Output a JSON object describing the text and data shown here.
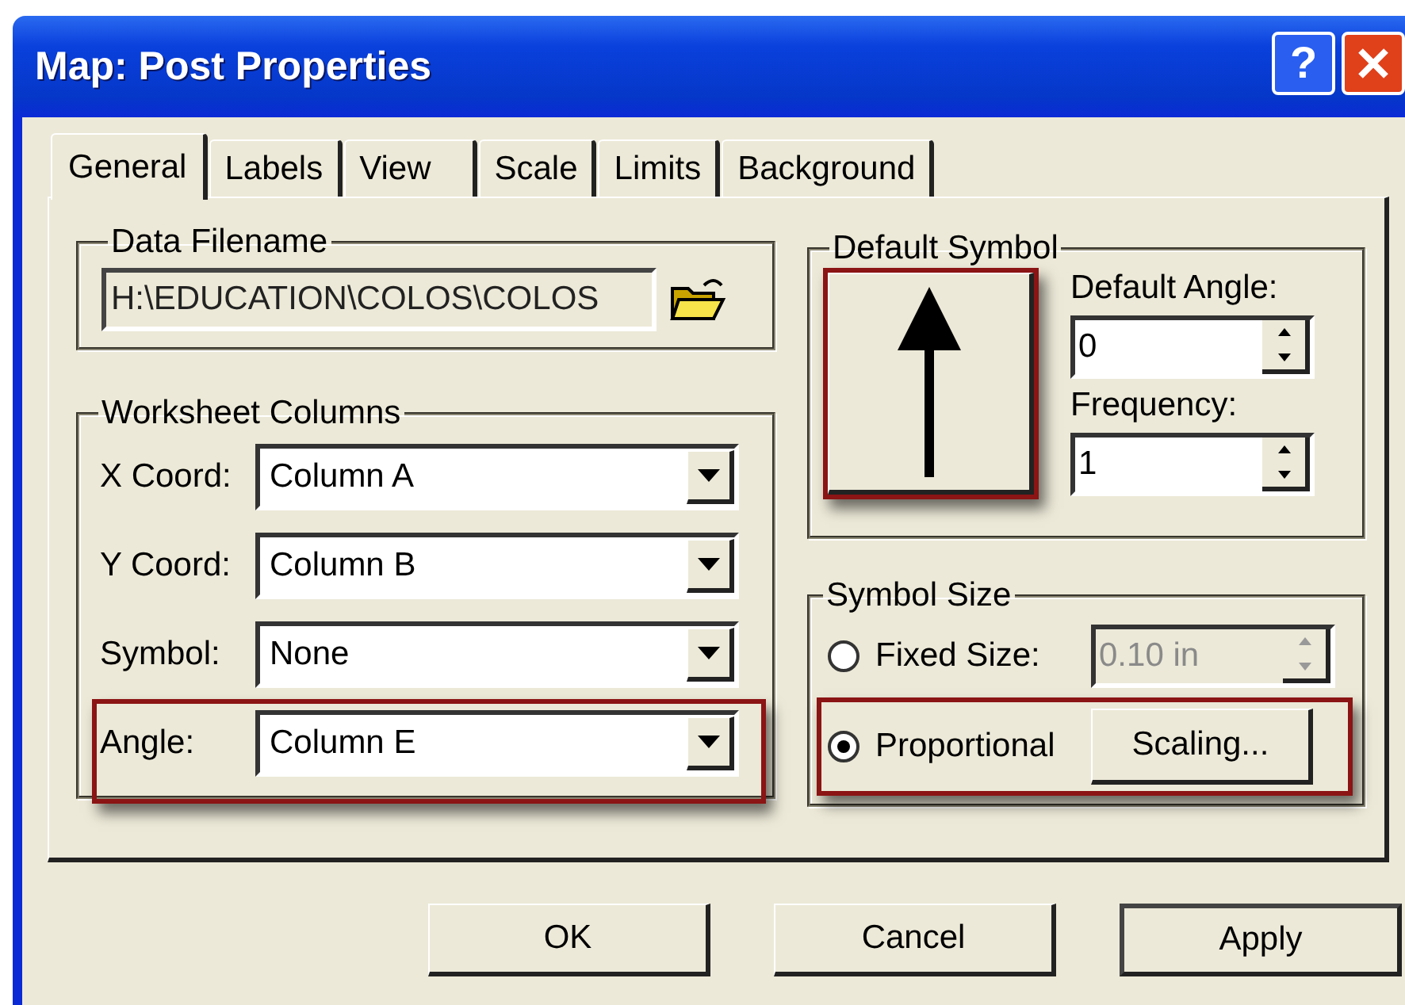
{
  "window": {
    "title": "Map: Post Properties",
    "help_label": "?"
  },
  "tabs": [
    {
      "label": "General",
      "selected": true
    },
    {
      "label": "Labels",
      "selected": false
    },
    {
      "label": "View",
      "selected": false
    },
    {
      "label": "Scale",
      "selected": false
    },
    {
      "label": "Limits",
      "selected": false
    },
    {
      "label": "Background",
      "selected": false
    }
  ],
  "data_filename": {
    "label": "Data Filename",
    "value": "H:\\EDUCATION\\COLOS\\COLOS"
  },
  "worksheet_columns": {
    "label": "Worksheet Columns",
    "rows": [
      {
        "label": "X Coord:",
        "value": "Column A",
        "highlighted": false
      },
      {
        "label": "Y Coord:",
        "value": "Column B",
        "highlighted": false
      },
      {
        "label": "Symbol:",
        "value": "None",
        "highlighted": false
      },
      {
        "label": "Angle:",
        "value": "Column E",
        "highlighted": true
      }
    ]
  },
  "default_symbol": {
    "label": "Default Symbol",
    "highlighted": true,
    "fields": [
      {
        "label": "Default Angle:",
        "value": "0"
      },
      {
        "label": "Frequency:",
        "value": "1"
      }
    ]
  },
  "symbol_size": {
    "label": "Symbol Size",
    "options": [
      {
        "kind": "spinner",
        "label": "Fixed Size:",
        "selected": false,
        "highlighted": false,
        "value": "0.10 in",
        "disabled": true
      },
      {
        "kind": "button",
        "label": "Proportional",
        "selected": true,
        "highlighted": true,
        "button": "Scaling..."
      }
    ]
  },
  "buttons": [
    {
      "label": "OK",
      "default": false
    },
    {
      "label": "Cancel",
      "default": false
    },
    {
      "label": "Apply",
      "default": true
    }
  ]
}
